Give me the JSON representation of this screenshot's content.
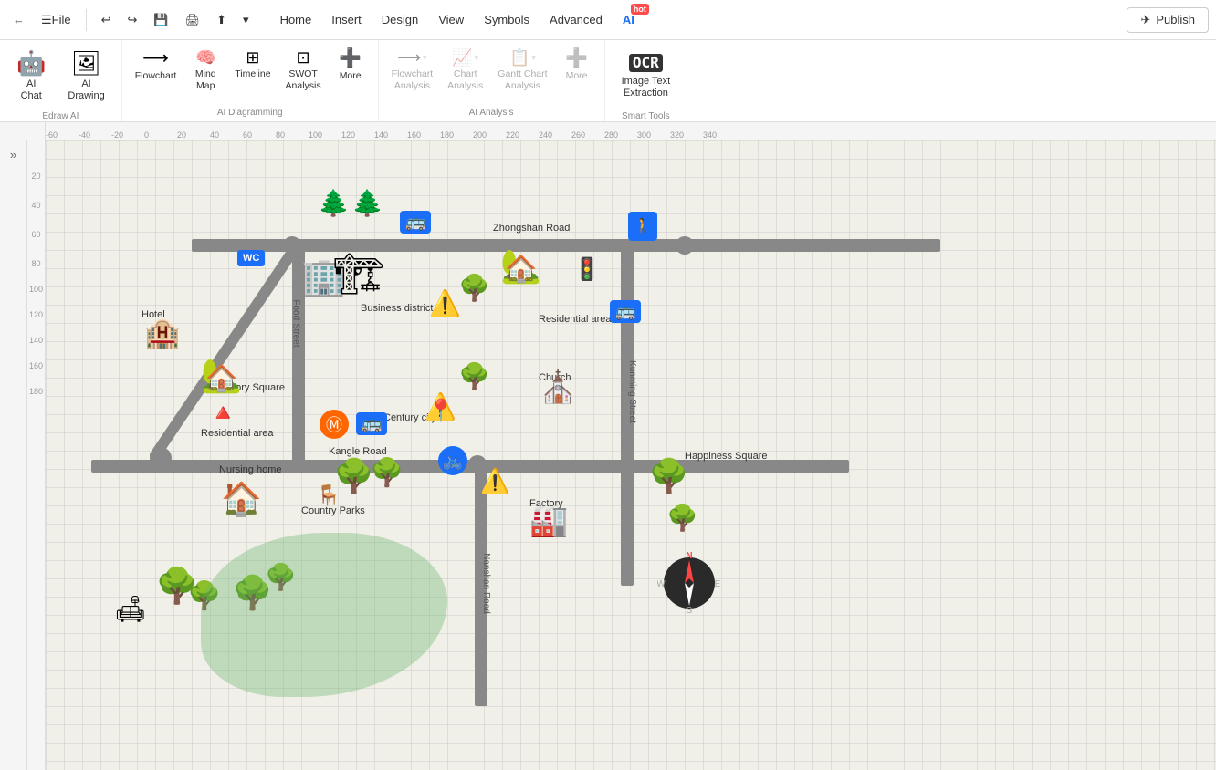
{
  "topbar": {
    "back_label": "←",
    "file_label": "File",
    "undo_label": "↩",
    "redo_label": "↪",
    "save_label": "💾",
    "print_label": "🖨",
    "share_label": "⬆",
    "dropdown_label": "▾",
    "publish_label": "Publish",
    "menus": [
      "Home",
      "Insert",
      "Design",
      "View",
      "Symbols",
      "Advanced",
      "AI"
    ]
  },
  "ribbon": {
    "edraw_ai": {
      "label": "Edraw AI",
      "items": [
        {
          "id": "ai-chat",
          "icon": "🤖",
          "label": "AI\nChat"
        },
        {
          "id": "ai-drawing",
          "icon": "🖼",
          "label": "AI\nDrawing"
        }
      ]
    },
    "ai_diagramming": {
      "label": "AI Diagramming",
      "items": [
        {
          "id": "flowchart",
          "icon": "🔀",
          "label": "Flowchart"
        },
        {
          "id": "mind-map",
          "icon": "🧠",
          "label": "Mind\nMap"
        },
        {
          "id": "timeline",
          "icon": "📅",
          "label": "Timeline"
        },
        {
          "id": "swot",
          "icon": "📊",
          "label": "SWOT\nAnalysis"
        },
        {
          "id": "more-diagramming",
          "icon": "➕",
          "label": "More"
        }
      ]
    },
    "ai_analysis": {
      "label": "AI Analysis",
      "items": [
        {
          "id": "flowchart-analysis",
          "icon": "🔀",
          "label": "Flowchart\nAnalysis",
          "disabled": true,
          "has_arrow": true
        },
        {
          "id": "chart-analysis",
          "icon": "📈",
          "label": "Chart\nAnalysis",
          "disabled": true,
          "has_arrow": true
        },
        {
          "id": "gantt-analysis",
          "icon": "📊",
          "label": "Gantt Chart\nAnalysis",
          "disabled": true,
          "has_arrow": true
        },
        {
          "id": "more-analysis",
          "icon": "➕",
          "label": "More",
          "disabled": true
        }
      ]
    },
    "smart_tools": {
      "label": "Smart Tools",
      "items": [
        {
          "id": "image-text",
          "icon": "OCR",
          "label": "Image Text\nExtraction"
        }
      ]
    }
  },
  "canvas": {
    "roads": {
      "zhongshan": "Zhongshan Road",
      "kangle": "Kangle Road",
      "nanshan": "Nanshan Road",
      "food": "Food Street",
      "kunming": "Kunming Street"
    },
    "locations": {
      "victory_square": "Victory Square",
      "happiness_square": "Happiness Square",
      "business_district": "Business district",
      "hotel": "Hotel",
      "residential_area_left": "Residential area",
      "residential_area_right": "Residential area",
      "century_city": "Century city",
      "church": "Church",
      "nursing_home": "Nursing home",
      "country_parks": "Country Parks",
      "factory": "Factory"
    },
    "compass": {
      "N": "N",
      "S": "S",
      "E": "E",
      "W": "W"
    }
  },
  "ruler": {
    "h_ticks": [
      "-60",
      "-40",
      "-20",
      "0",
      "20",
      "40",
      "60",
      "80",
      "100",
      "120",
      "140",
      "160",
      "180",
      "200",
      "220",
      "240",
      "260",
      "280",
      "300",
      "320",
      "340"
    ],
    "v_ticks": [
      "20",
      "40",
      "60",
      "80",
      "100",
      "120",
      "140",
      "160",
      "180"
    ]
  }
}
